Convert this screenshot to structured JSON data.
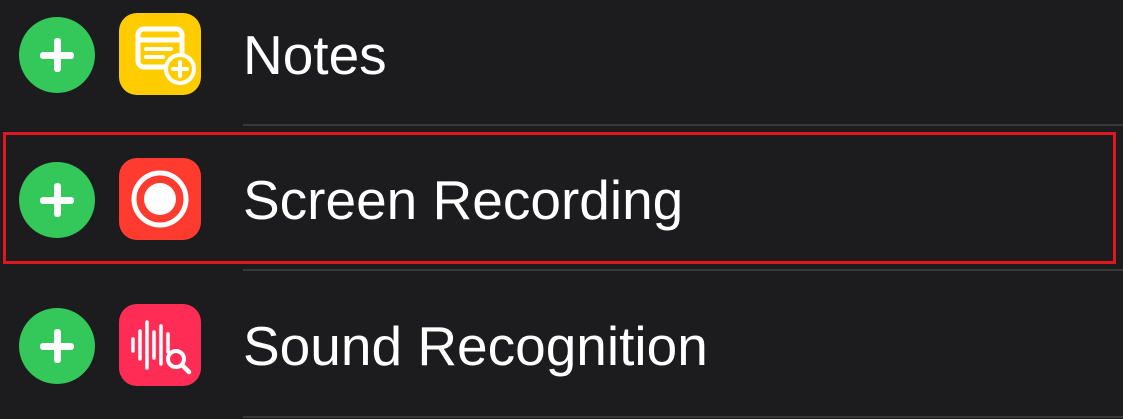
{
  "items": [
    {
      "label": "Notes",
      "icon": "notes-icon",
      "icon_color": "#ffcc00"
    },
    {
      "label": "Screen Recording",
      "icon": "record-icon",
      "icon_color": "#ff3b30"
    },
    {
      "label": "Sound Recognition",
      "icon": "waveform-magnifier-icon",
      "icon_color": "#ff2d55"
    }
  ],
  "colors": {
    "background": "#1c1c1e",
    "add_button": "#34c759",
    "separator": "#38383a",
    "highlight_border": "#e0161e"
  }
}
